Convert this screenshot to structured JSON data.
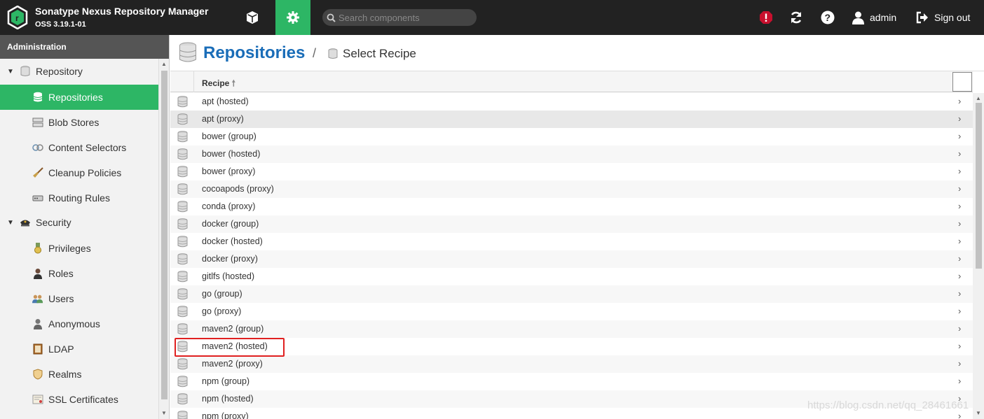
{
  "app": {
    "title": "Sonatype Nexus Repository Manager",
    "version": "OSS 3.19.1-01"
  },
  "topbar": {
    "search_placeholder": "Search components",
    "user": "admin",
    "signout": "Sign out",
    "accent": "#2db665",
    "alert_color": "#c8102e"
  },
  "sidebar": {
    "header": "Administration",
    "groups": [
      {
        "label": "Repository",
        "icon": "database-icon"
      },
      {
        "label": "Security",
        "icon": "police-hat-icon"
      }
    ],
    "items": [
      {
        "label": "Repositories",
        "icon": "database-stack-icon"
      },
      {
        "label": "Blob Stores",
        "icon": "server-icon"
      },
      {
        "label": "Content Selectors",
        "icon": "content-selector-icon"
      },
      {
        "label": "Cleanup Policies",
        "icon": "broom-icon"
      },
      {
        "label": "Routing Rules",
        "icon": "router-icon"
      },
      {
        "label": "Privileges",
        "icon": "medal-icon"
      },
      {
        "label": "Roles",
        "icon": "user-role-icon"
      },
      {
        "label": "Users",
        "icon": "users-icon"
      },
      {
        "label": "Anonymous",
        "icon": "anonymous-user-icon"
      },
      {
        "label": "LDAP",
        "icon": "book-icon"
      },
      {
        "label": "Realms",
        "icon": "shield-icon"
      },
      {
        "label": "SSL Certificates",
        "icon": "certificate-icon"
      }
    ]
  },
  "page": {
    "title": "Repositories",
    "breadcrumb_sep": "/",
    "subtitle": "Select Recipe",
    "column": "Recipe"
  },
  "recipes": [
    "apt (hosted)",
    "apt (proxy)",
    "bower (group)",
    "bower (hosted)",
    "bower (proxy)",
    "cocoapods (proxy)",
    "conda (proxy)",
    "docker (group)",
    "docker (hosted)",
    "docker (proxy)",
    "gitlfs (hosted)",
    "go (group)",
    "go (proxy)",
    "maven2 (group)",
    "maven2 (hosted)",
    "maven2 (proxy)",
    "npm (group)",
    "npm (hosted)",
    "npm (proxy)"
  ],
  "watermark": "https://blog.csdn.net/qq_28461661"
}
